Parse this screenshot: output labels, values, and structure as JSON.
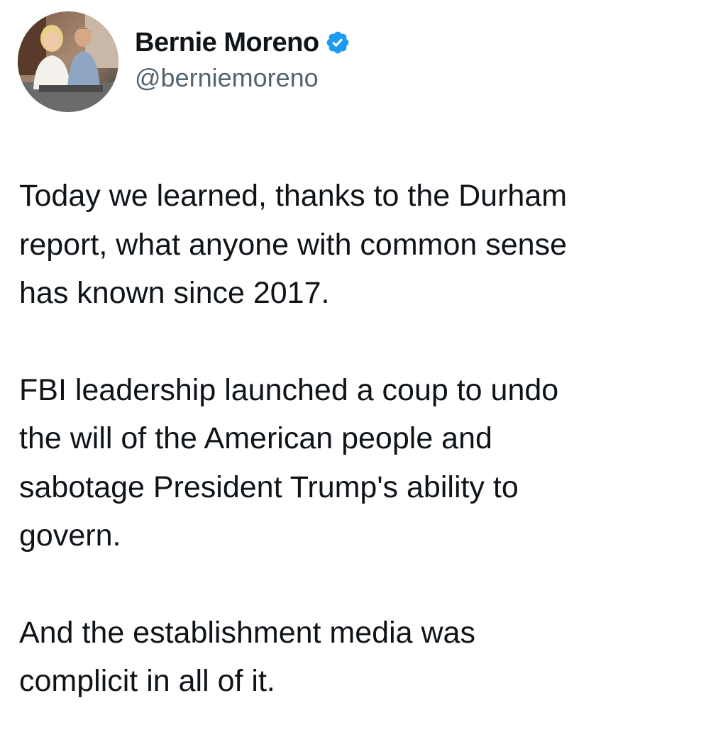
{
  "author": {
    "display_name": "Bernie Moreno",
    "handle": "@berniemoreno",
    "verified": true,
    "verified_color": "#1d9bf0"
  },
  "tweet": {
    "paragraphs": [
      {
        "lines": [
          "Today we learned, thanks to the Durham",
          "report, what anyone with common sense",
          "has known since 2017."
        ]
      },
      {
        "lines": [
          "FBI leadership launched a coup to undo",
          "the will of the American people and",
          "sabotage President Trump's ability to",
          "govern."
        ]
      },
      {
        "lines": [
          "And the establishment media was",
          "complicit in all of it."
        ]
      }
    ]
  },
  "icons": {
    "verified_badge": "verified-badge-icon",
    "avatar": "profile-photo"
  }
}
